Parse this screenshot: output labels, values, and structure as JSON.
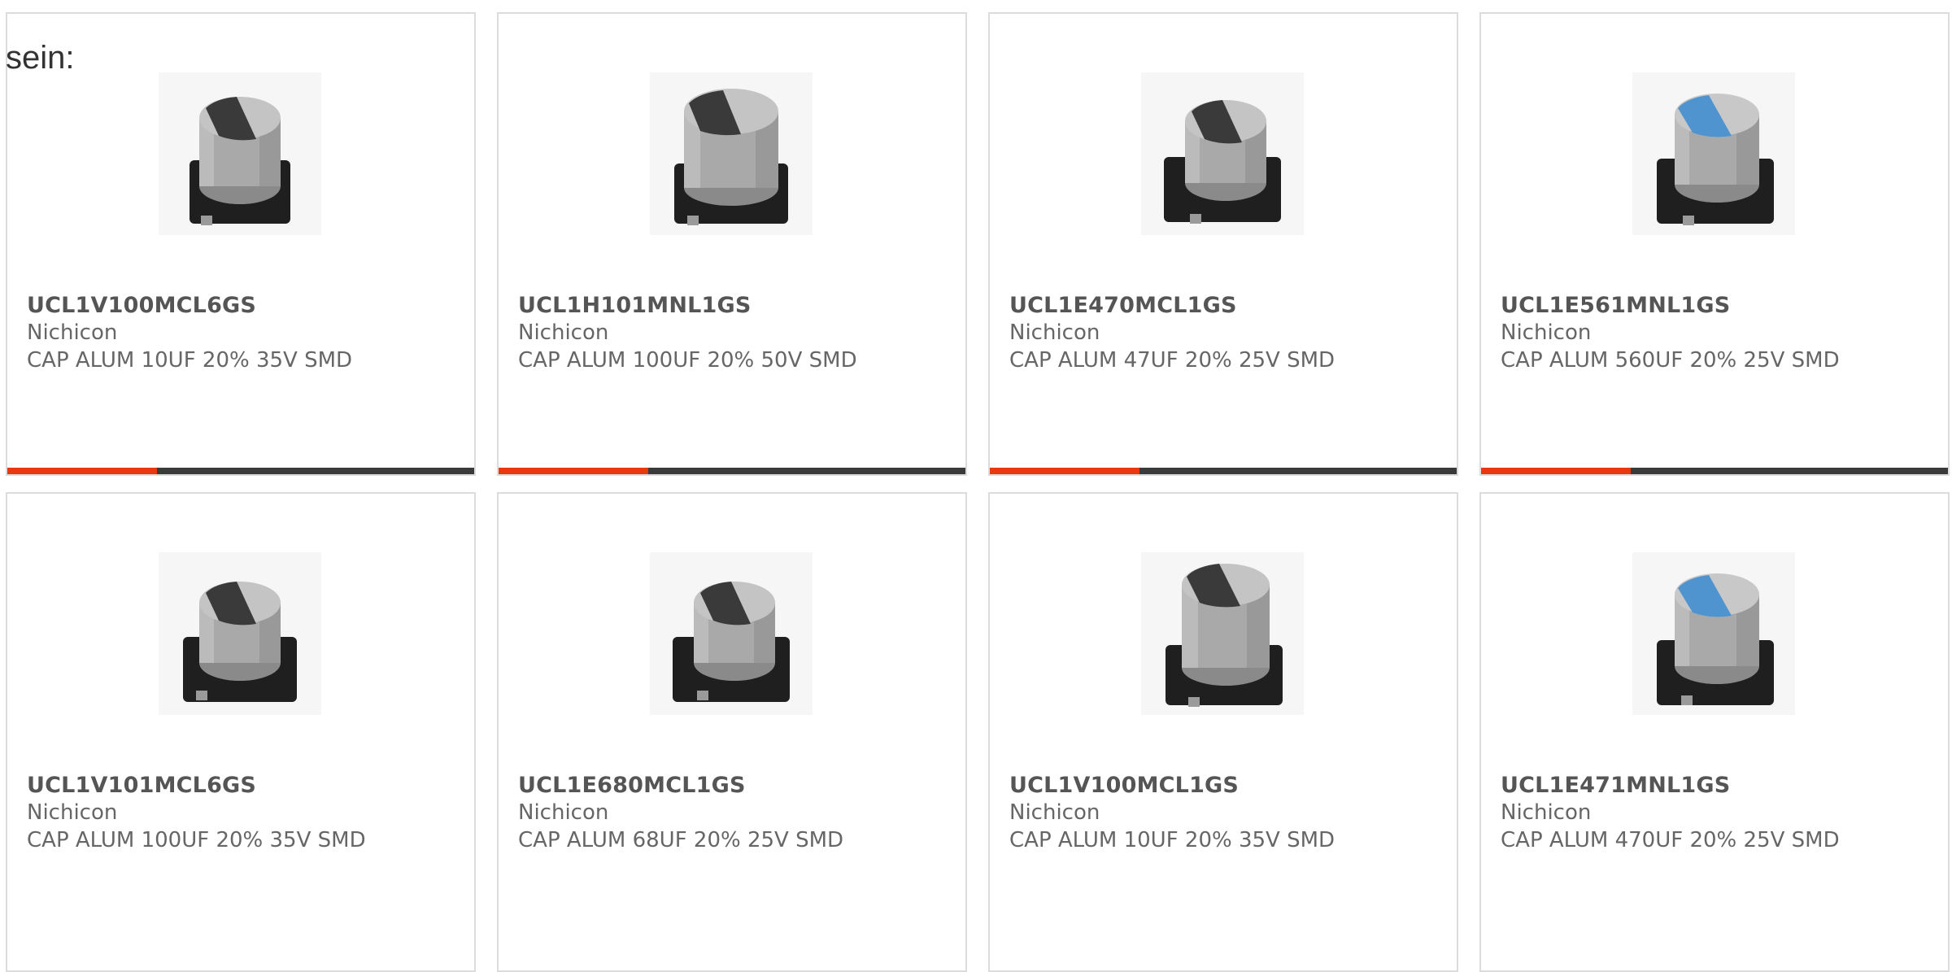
{
  "intro": "sein:",
  "colors": {
    "accent": "#e8380d",
    "bar_track": "#3a3a3a",
    "card_border": "#dcdcdc",
    "text": "#666666",
    "cap_top_plain": "#bfbfbf",
    "cap_top_blue": "#4f94cf"
  },
  "cards": [
    {
      "part": "UCL1V100MCL6GS",
      "manufacturer": "Nichicon",
      "description": "CAP ALUM 10UF 20% 35V SMD",
      "image": "smd-electrolytic-capacitor",
      "marking": "dark",
      "progress": 0.32
    },
    {
      "part": "UCL1H101MNL1GS",
      "manufacturer": "Nichicon",
      "description": "CAP ALUM 100UF 20% 50V SMD",
      "image": "smd-electrolytic-capacitor",
      "marking": "dark",
      "progress": 0.32
    },
    {
      "part": "UCL1E470MCL1GS",
      "manufacturer": "Nichicon",
      "description": "CAP ALUM 47UF 20% 25V SMD",
      "image": "smd-electrolytic-capacitor",
      "marking": "dark",
      "progress": 0.32
    },
    {
      "part": "UCL1E561MNL1GS",
      "manufacturer": "Nichicon",
      "description": "CAP ALUM 560UF 20% 25V SMD",
      "image": "smd-electrolytic-capacitor",
      "marking": "blue",
      "progress": 0.32
    },
    {
      "part": "UCL1V101MCL6GS",
      "manufacturer": "Nichicon",
      "description": "CAP ALUM 100UF 20% 35V SMD",
      "image": "smd-electrolytic-capacitor",
      "marking": "dark"
    },
    {
      "part": "UCL1E680MCL1GS",
      "manufacturer": "Nichicon",
      "description": "CAP ALUM 68UF 20% 25V SMD",
      "image": "smd-electrolytic-capacitor",
      "marking": "dark"
    },
    {
      "part": "UCL1V100MCL1GS",
      "manufacturer": "Nichicon",
      "description": "CAP ALUM 10UF 20% 35V SMD",
      "image": "smd-electrolytic-capacitor",
      "marking": "dark"
    },
    {
      "part": "UCL1E471MNL1GS",
      "manufacturer": "Nichicon",
      "description": "CAP ALUM 470UF 20% 25V SMD",
      "image": "smd-electrolytic-capacitor",
      "marking": "blue"
    }
  ]
}
